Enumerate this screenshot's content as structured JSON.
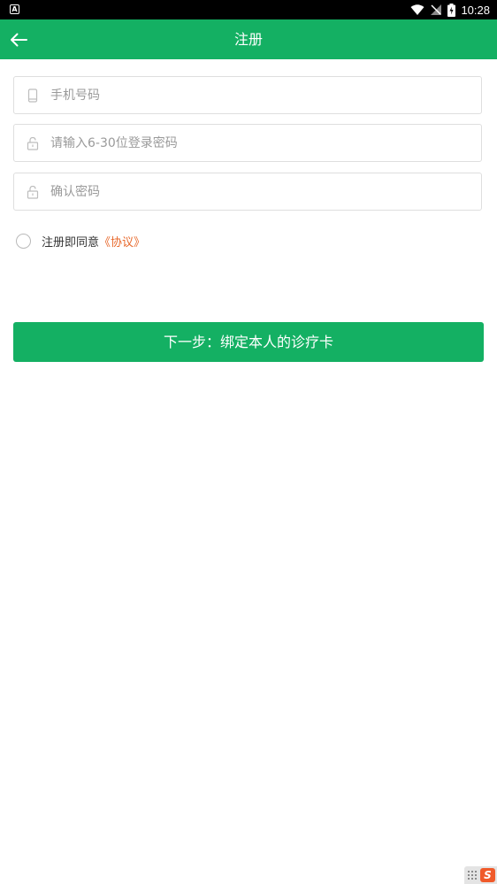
{
  "status_bar": {
    "time": "10:28",
    "notification_icon": "A"
  },
  "header": {
    "title": "注册"
  },
  "form": {
    "phone": {
      "placeholder": "手机号码",
      "value": ""
    },
    "password": {
      "placeholder": "请输入6-30位登录密码",
      "value": ""
    },
    "confirm_password": {
      "placeholder": "确认密码",
      "value": ""
    }
  },
  "agreement": {
    "text": "注册即同意",
    "link": "《协议》",
    "checked": false
  },
  "next_button": {
    "label": "下一步：绑定本人的诊疗卡"
  },
  "keyboard_indicator": {
    "label": "S"
  },
  "colors": {
    "primary": "#14b063",
    "link": "#e8692c",
    "border": "#dedede"
  }
}
